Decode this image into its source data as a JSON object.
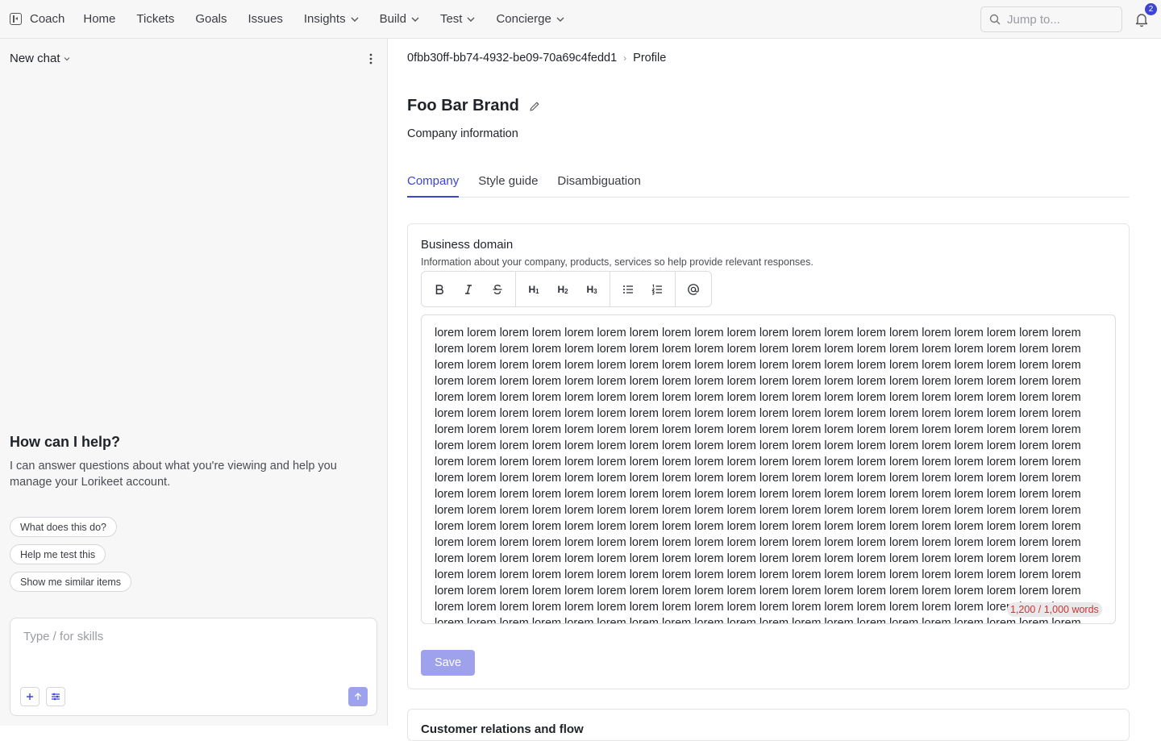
{
  "nav": {
    "brand": "Coach",
    "items": [
      {
        "label": "Home",
        "dropdown": false
      },
      {
        "label": "Tickets",
        "dropdown": false
      },
      {
        "label": "Goals",
        "dropdown": false
      },
      {
        "label": "Issues",
        "dropdown": false
      },
      {
        "label": "Insights",
        "dropdown": true
      },
      {
        "label": "Build",
        "dropdown": true
      },
      {
        "label": "Test",
        "dropdown": true
      },
      {
        "label": "Concierge",
        "dropdown": true
      }
    ],
    "search_placeholder": "Jump to...",
    "notification_count": "2",
    "accent": "#3c44d6"
  },
  "chat": {
    "title": "New chat",
    "help_title": "How can I help?",
    "help_desc": "I can answer questions about what you're viewing and help you manage your Lorikeet account.",
    "suggestions": [
      "What does this do?",
      "Help me test this",
      "Show me similar items"
    ],
    "composer_placeholder": "Type / for skills"
  },
  "main": {
    "breadcrumb": [
      "0fbb30ff-bb74-4932-be09-70a69c4fedd1",
      "Profile"
    ],
    "title": "Foo Bar Brand",
    "subtitle": "Company information",
    "tabs": [
      {
        "label": "Company",
        "active": true
      },
      {
        "label": "Style guide",
        "active": false
      },
      {
        "label": "Disambiguation",
        "active": false
      }
    ],
    "business_domain": {
      "label": "Business domain",
      "help": "Information about your company, products, services so help provide relevant responses.",
      "toolbar": [
        "bold-icon",
        "italic-icon",
        "strikethrough-icon",
        "heading-1-icon",
        "heading-2-icon",
        "heading-3-icon",
        "bullet-list-icon",
        "numbered-list-icon",
        "mention-icon"
      ],
      "word": "lorem",
      "word_count_text": "1,200 / 1,000 words",
      "save_label": "Save"
    },
    "next_section_label": "Customer relations and flow"
  }
}
